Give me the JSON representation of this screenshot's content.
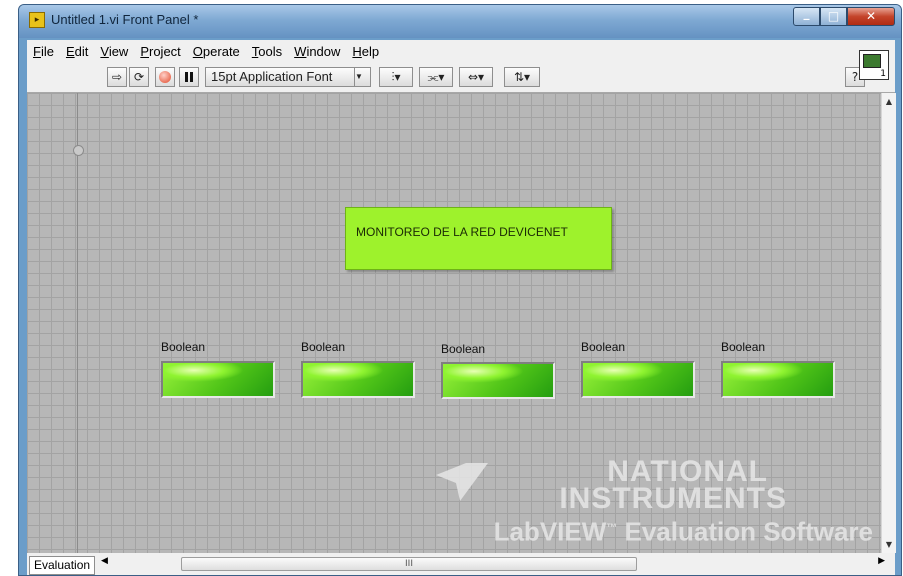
{
  "window": {
    "title": "Untitled 1.vi Front Panel *",
    "controls": [
      "minimize",
      "maximize",
      "close"
    ]
  },
  "menu": [
    {
      "accel": "F",
      "rest": "ile"
    },
    {
      "accel": "E",
      "rest": "dit"
    },
    {
      "accel": "V",
      "rest": "iew"
    },
    {
      "accel": "P",
      "rest": "roject"
    },
    {
      "accel": "O",
      "rest": "perate"
    },
    {
      "accel": "T",
      "rest": "ools"
    },
    {
      "accel": "W",
      "rest": "indow"
    },
    {
      "accel": "H",
      "rest": "elp"
    }
  ],
  "toolbar": {
    "font_selector": "15pt Application Font",
    "help_label": "?",
    "icons": [
      "run-arrow-icon",
      "run-continuously-icon",
      "abort-icon",
      "pause-icon",
      "align-objects-icon",
      "distribute-objects-icon",
      "resize-objects-icon",
      "reorder-icon",
      "context-help-icon"
    ],
    "vi_icon_number": "1"
  },
  "panel": {
    "title_text": "MONITOREO DE LA RED DEVICENET",
    "title_color": "#9ef22c",
    "booleans": [
      {
        "label": "Boolean"
      },
      {
        "label": "Boolean"
      },
      {
        "label": "Boolean"
      },
      {
        "label": "Boolean"
      },
      {
        "label": "Boolean"
      }
    ],
    "led_color": "#52c619"
  },
  "watermark": {
    "line1": "NATIONAL",
    "line2": "INSTRUMENTS",
    "line3_brand": "LabVIEW",
    "line3_tm": "™",
    "line3_rest": "Evaluation Software"
  },
  "status": {
    "tab": "Evaluation",
    "scroll_grip": "III"
  }
}
